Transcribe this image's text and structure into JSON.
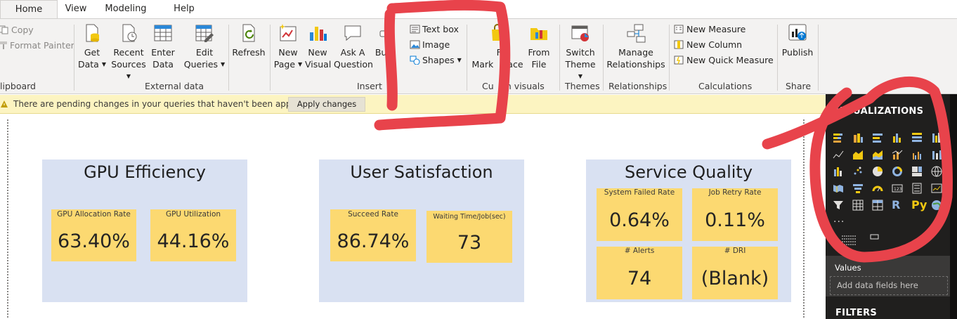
{
  "tabs": {
    "home": "Home",
    "view": "View",
    "modeling": "Modeling",
    "help": "Help"
  },
  "ribbon": {
    "clipboard": {
      "copy": "Copy",
      "format_painter": "Format Painter",
      "label": "lipboard"
    },
    "external_data": {
      "get_data_1": "Get",
      "get_data_2": "Data",
      "recent_sources_1": "Recent",
      "recent_sources_2": "Sources",
      "enter_data_1": "Enter",
      "enter_data_2": "Data",
      "edit_queries_1": "Edit",
      "edit_queries_2": "Queries",
      "refresh": "Refresh",
      "label": "External data"
    },
    "insert": {
      "new_page_1": "New",
      "new_page_2": "Page",
      "new_visual_1": "New",
      "new_visual_2": "Visual",
      "ask_question_1": "Ask A",
      "ask_question_2": "Question",
      "buttons": "Butt",
      "text_box": "Text box",
      "image": "Image",
      "shapes": "Shapes",
      "label": "Insert"
    },
    "custom_visuals": {
      "from_marketplace_1": "Fro",
      "from_marketplace_2": "Mark",
      "from_marketplace_3": "ace",
      "from_file_1": "From",
      "from_file_2": "File",
      "label_1": "Cu",
      "label_2": "m visuals"
    },
    "themes": {
      "switch_theme_1": "Switch",
      "switch_theme_2": "Theme",
      "label": "Themes"
    },
    "relationships": {
      "manage_1": "Manage",
      "manage_2": "Relationships",
      "label": "Relationships"
    },
    "calculations": {
      "new_measure": "New Measure",
      "new_column": "New Column",
      "new_quick_measure": "New Quick Measure",
      "label": "Calculations"
    },
    "share": {
      "publish": "Publish",
      "label": "Share"
    }
  },
  "notification": {
    "message": "There are pending changes in your queries that haven't been applied.",
    "apply_button": "Apply changes"
  },
  "panels": [
    {
      "title": "GPU Efficiency",
      "cards": [
        {
          "label": "GPU Allocation Rate",
          "value": "63.40%"
        },
        {
          "label": "GPU Utilization",
          "value": "44.16%"
        }
      ]
    },
    {
      "title": "User  Satisfaction",
      "cards": [
        {
          "label": "Succeed Rate",
          "value": "86.74%"
        },
        {
          "label": "Waiting Time/Job(sec)",
          "value": "73"
        }
      ]
    },
    {
      "title": "Service Quality",
      "cards": [
        {
          "label": "System Failed Rate",
          "value": "0.64%"
        },
        {
          "label": "Job Retry Rate",
          "value": "0.11%"
        },
        {
          "label": "# Alerts",
          "value": "74"
        },
        {
          "label": "# DRI",
          "value": "(Blank)"
        }
      ]
    }
  ],
  "visualizations": {
    "title": "VISUALIZATIONS",
    "chevron": "›",
    "r_icon": "R",
    "py_icon": "Py",
    "more": "...",
    "values_label": "Values",
    "add_fields": "Add data fields here",
    "filters": "FILTERS"
  },
  "colors": {
    "panel_bg": "#d9e1f2",
    "card_bg": "#fcd971",
    "notification_bg": "#fcf4c1",
    "pane_bg": "#201f1e",
    "annotation_red": "#e8434b"
  }
}
